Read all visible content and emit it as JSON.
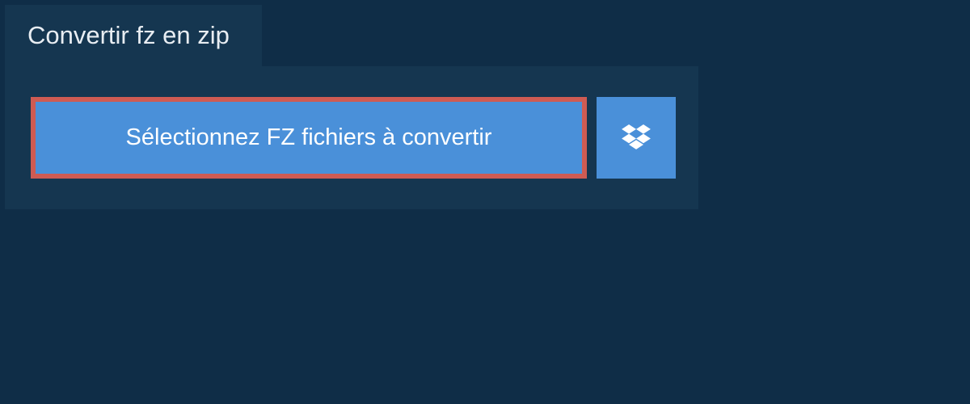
{
  "tab": {
    "title": "Convertir fz en zip"
  },
  "actions": {
    "select_label": "Sélectionnez FZ fichiers à convertir",
    "highlight_color": "#cf5b53",
    "button_bg": "#4a90d9"
  }
}
